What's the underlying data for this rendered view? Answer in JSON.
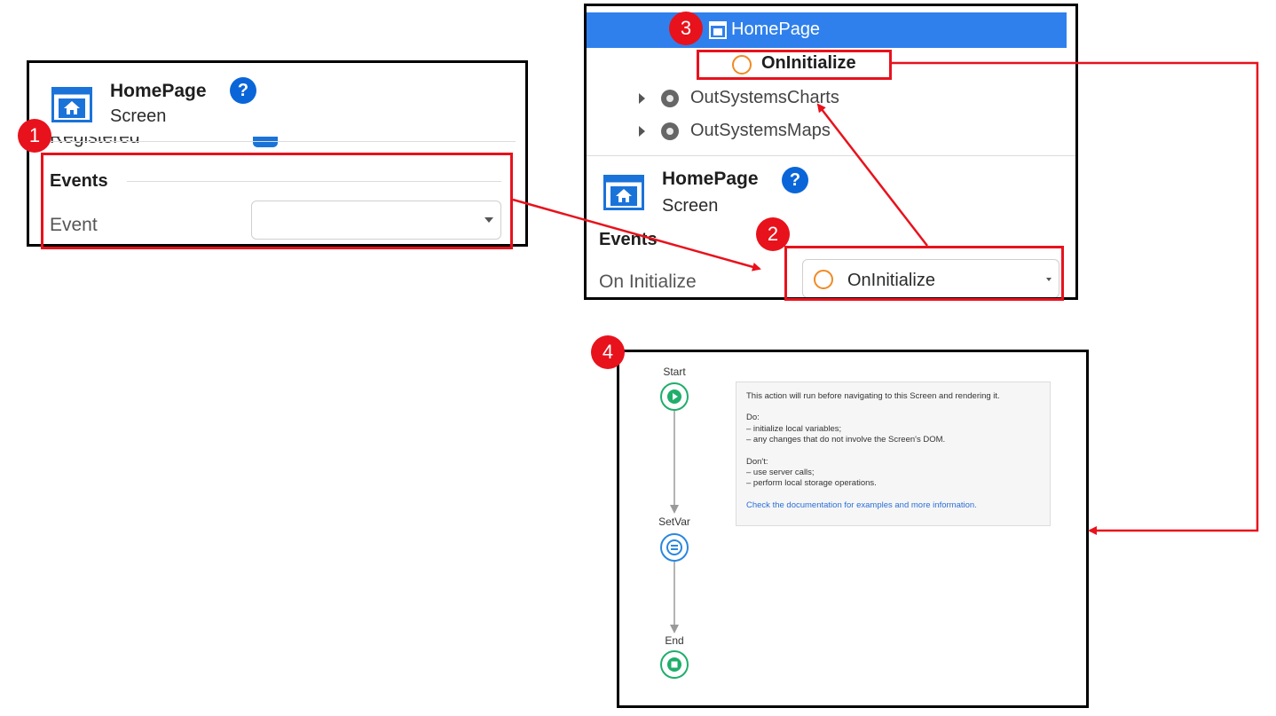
{
  "panel1": {
    "screen_title": "HomePage",
    "screen_subtitle": "Screen",
    "help_symbol": "?",
    "cut_label": "Registered",
    "events_header": "Events",
    "event_label": "Event",
    "event_value": ""
  },
  "panel2": {
    "tree": {
      "selected_item": "HomePage",
      "child_item": "OnInitialize",
      "items": [
        "OutSystemsCharts",
        "OutSystemsMaps"
      ]
    },
    "screen_title": "HomePage",
    "screen_subtitle": "Screen",
    "help_symbol": "?",
    "events_header": "Events",
    "oninit_label": "On Initialize",
    "oninit_value": "OnInitialize"
  },
  "flow": {
    "nodes": [
      {
        "label": "Start",
        "icon": "play-icon"
      },
      {
        "label": "SetVar",
        "icon": "assign-icon"
      },
      {
        "label": "End",
        "icon": "stop-icon"
      }
    ],
    "comment": {
      "intro": "This action will run before navigating to this Screen and rendering it.",
      "do_title": "Do:",
      "do_items": [
        "– initialize local variables;",
        "– any changes that do not involve the Screen's DOM."
      ],
      "dont_title": "Don't:",
      "dont_items": [
        "– use server calls;",
        "– perform local storage operations."
      ],
      "link": "Check the documentation for examples and more information."
    }
  },
  "badges": [
    "1",
    "2",
    "3",
    "4"
  ],
  "colors": {
    "annotation_red": "#e8121c",
    "selection_blue": "#2f80ed",
    "help_blue": "#0a66d8",
    "start_green": "#1fae6b",
    "setvar_blue": "#2a87e0",
    "oninit_orange": "#f08a24"
  }
}
